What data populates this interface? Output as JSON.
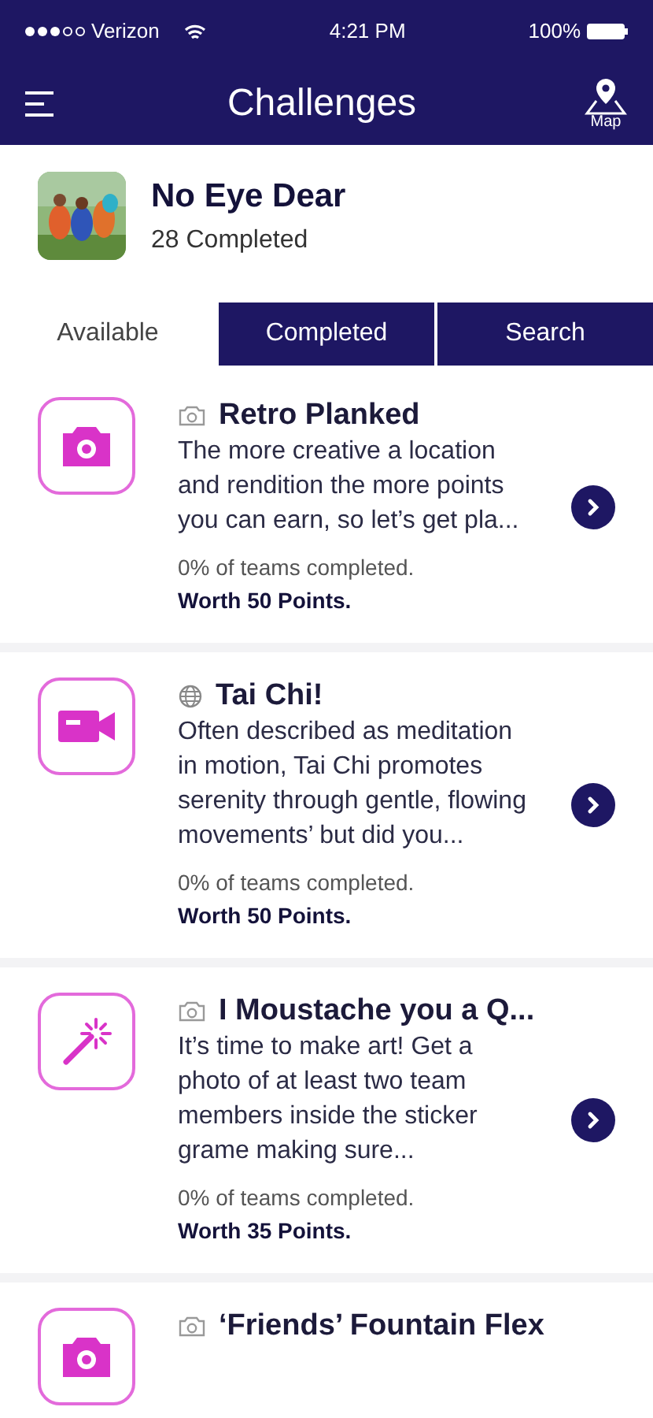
{
  "status_bar": {
    "carrier": "Verizon",
    "time": "4:21 PM",
    "battery": "100%"
  },
  "header": {
    "title": "Challenges",
    "map_label": "Map"
  },
  "team": {
    "name": "No Eye Dear",
    "completed": "28 Completed"
  },
  "tabs": [
    {
      "label": "Available",
      "selected": true
    },
    {
      "label": "Completed",
      "selected": false
    },
    {
      "label": "Search",
      "selected": false
    }
  ],
  "challenges": [
    {
      "title": "Retro Planked",
      "description": "The more creative a location and rendition the more points you can earn, so let’s get pla...",
      "progress": "0% of teams completed.",
      "worth": "Worth 50 Points."
    },
    {
      "kind": "video",
      "title": "Tai Chi!",
      "description": "Often described as meditation in motion, Tai Chi promotes serenity through gentle, flowing movements’ but did you...",
      "progress": "0% of teams completed.",
      "worth": "Worth 50 Points."
    },
    {
      "kind": "art",
      "title": "I Moustache you a Q...",
      "description": "It’s time to make art! Get a photo of at least two team members inside the sticker grame making sure...",
      "progress": "0% of teams completed.",
      "worth": "Worth 35 Points."
    },
    {
      "title": "‘Friends’ Fountain Flex"
    }
  ]
}
